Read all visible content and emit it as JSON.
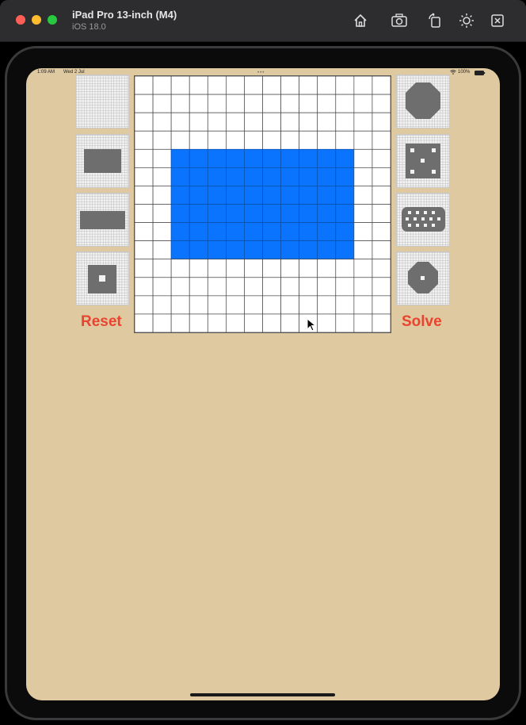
{
  "window": {
    "title": "iPad Pro 13-inch (M4)",
    "subtitle": "iOS 18.0",
    "toolbar_icons": [
      "home-icon",
      "screenshot-icon",
      "rotate-icon",
      "appearance-icon",
      "close-simulator-icon"
    ]
  },
  "status_bar": {
    "time": "1:09 AM",
    "date": "Wed 2 Jul",
    "battery": "100%"
  },
  "app": {
    "reset_label": "Reset",
    "solve_label": "Solve",
    "grid_size": 14,
    "fill_color": "#0a74ff",
    "filled_region": {
      "col_start": 2,
      "col_end": 11,
      "row_start": 4,
      "row_end": 9
    },
    "left_presets": [
      "empty-pattern",
      "rectangle-pattern",
      "wide-bar-pattern",
      "hollow-square-pattern"
    ],
    "right_presets": [
      "octagon-pattern",
      "dice-pattern",
      "perforated-pattern",
      "circle-hole-pattern"
    ]
  }
}
